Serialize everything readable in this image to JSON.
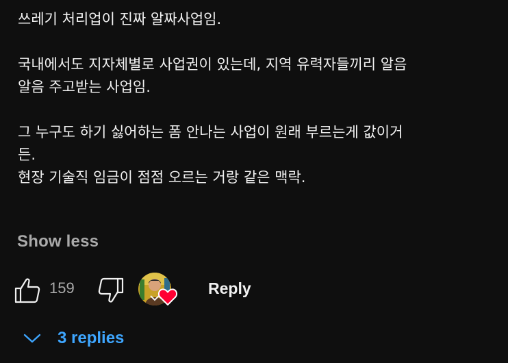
{
  "comment": {
    "paragraphs": [
      [
        "쓰레기 처리업이 진짜 알짜사업임."
      ],
      [
        "국내에서도 지자체별로 사업권이 있는데, 지역 유력자들끼리 알음",
        "알음 주고받는 사업임."
      ],
      [
        "그 누구도 하기 싫어하는 폼 안나는 사업이 원래 부르는게 값이거",
        "든.",
        "현장 기술직 임금이 점점 오르는 거랑 같은 맥락."
      ]
    ],
    "show_less": "Show less"
  },
  "actions": {
    "like_count": "159",
    "reply_label": "Reply",
    "like_icon": "thumb-up-icon",
    "dislike_icon": "thumb-down-icon",
    "heart_icon": "heart-icon",
    "heart_color": "#ff0033"
  },
  "replies": {
    "label": "3 replies",
    "icon": "chevron-down-icon",
    "color": "#3ea6ff"
  }
}
